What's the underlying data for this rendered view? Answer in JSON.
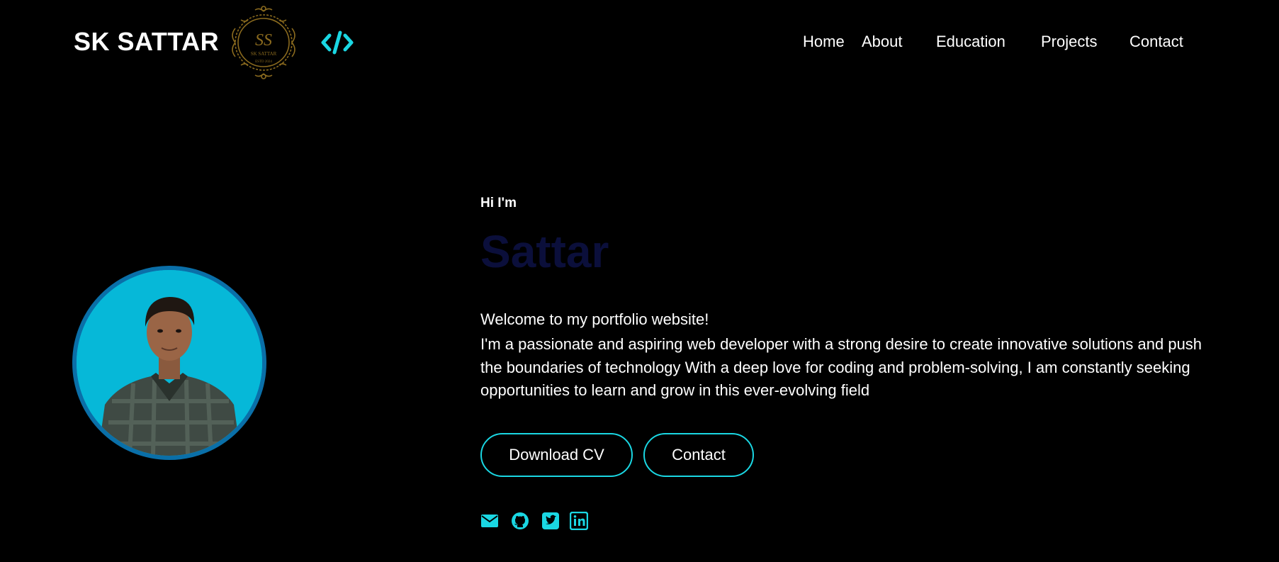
{
  "header": {
    "brand": "SK SATTAR",
    "emblem_icon": "sk-sattar-emblem-logo",
    "code_icon": "code-brackets-icon",
    "accent_color": "#1ad7e3"
  },
  "nav": {
    "items": [
      {
        "label": "Home"
      },
      {
        "label": "About"
      },
      {
        "label": "Education"
      },
      {
        "label": "Projects"
      },
      {
        "label": "Contact"
      }
    ]
  },
  "hero": {
    "greeting": "Hi I'm",
    "name": "Sattar",
    "welcome": "Welcome to my portfolio website!",
    "bio": "I'm a passionate and aspiring web developer with a strong desire to create innovative solutions and push the boundaries of technology With a deep love for coding and problem-solving, I am constantly seeking opportunities to learn and grow in this ever-evolving field",
    "buttons": {
      "download_cv": "Download CV",
      "contact": "Contact"
    },
    "social_icons": [
      "envelope-icon",
      "github-icon",
      "twitter-icon",
      "linkedin-icon"
    ],
    "avatar_bg_color": "#06b8d8",
    "avatar_border_color": "#0a6fa8",
    "name_color": "#0b0f3b"
  }
}
